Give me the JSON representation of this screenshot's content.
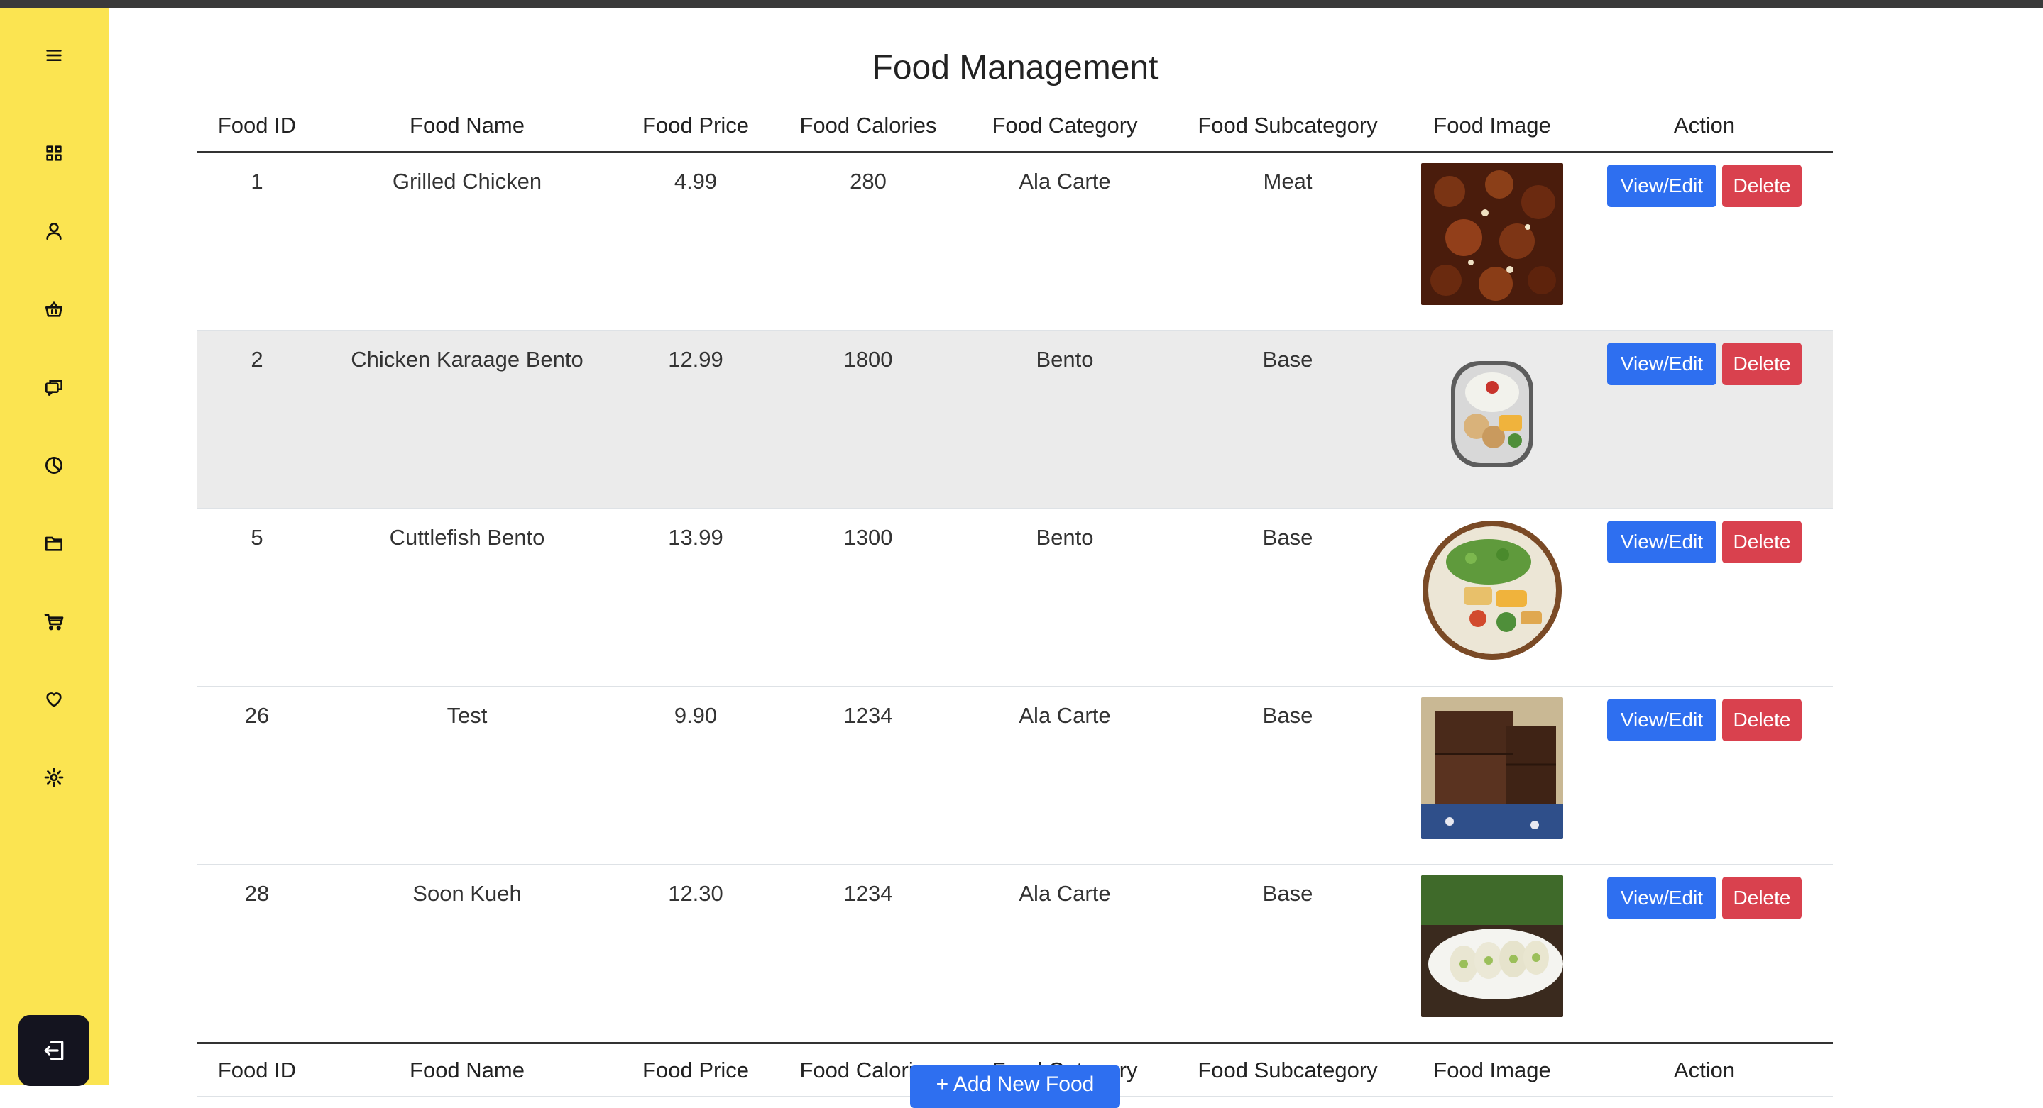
{
  "page": {
    "title": "Food Management",
    "add_button": "+ Add New Food"
  },
  "sidebar": {
    "icons": [
      "menu-icon",
      "dashboard-icon",
      "user-icon",
      "basket-icon",
      "chat-icon",
      "pie-chart-icon",
      "folder-icon",
      "cart-icon",
      "heart-icon",
      "settings-icon"
    ],
    "logout_icon": "logout-icon",
    "background": "#fbe451"
  },
  "table": {
    "headers": [
      "Food ID",
      "Food Name",
      "Food Price",
      "Food Calories",
      "Food Category",
      "Food Subcategory",
      "Food Image",
      "Action"
    ],
    "actions": {
      "edit": "View/Edit",
      "delete": "Delete"
    },
    "rows": [
      {
        "id": "1",
        "name": "Grilled Chicken",
        "price": "4.99",
        "calories": "280",
        "category": "Ala Carte",
        "subcategory": "Meat",
        "image": "grilled-chicken"
      },
      {
        "id": "2",
        "name": "Chicken Karaage Bento",
        "price": "12.99",
        "calories": "1800",
        "category": "Bento",
        "subcategory": "Base",
        "image": "karaage-bento"
      },
      {
        "id": "5",
        "name": "Cuttlefish Bento",
        "price": "13.99",
        "calories": "1300",
        "category": "Bento",
        "subcategory": "Base",
        "image": "cuttlefish-bento"
      },
      {
        "id": "26",
        "name": "Test",
        "price": "9.90",
        "calories": "1234",
        "category": "Ala Carte",
        "subcategory": "Base",
        "image": "brownie"
      },
      {
        "id": "28",
        "name": "Soon Kueh",
        "price": "12.30",
        "calories": "1234",
        "category": "Ala Carte",
        "subcategory": "Base",
        "image": "soon-kueh"
      }
    ]
  },
  "colors": {
    "accent": "#2e6ff0",
    "danger": "#d9414e",
    "sidebar": "#fbe451"
  }
}
